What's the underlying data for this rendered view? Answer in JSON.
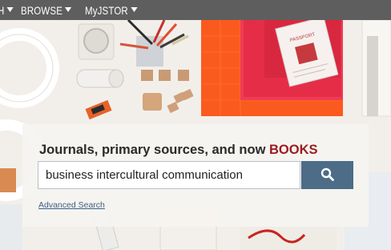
{
  "nav": {
    "search_label": "H",
    "browse_label": "BROWSE",
    "myjstor_label": "MyJSTOR"
  },
  "hero": {
    "headline_prefix": "Journals, primary sources, and now ",
    "headline_accent": "BOOKS",
    "search_value": "business intercultural communication",
    "advanced_search_label": "Advanced Search",
    "passport_text": "PASSPORT"
  },
  "colors": {
    "nav_bg": "#5e5e5e",
    "accent_red": "#9a1b1f",
    "search_button": "#4c6c87",
    "link": "#3d5f86"
  },
  "icons": {
    "search_button_icon": "magnifier-icon",
    "nav_caret_icon": "caret-down-icon"
  }
}
